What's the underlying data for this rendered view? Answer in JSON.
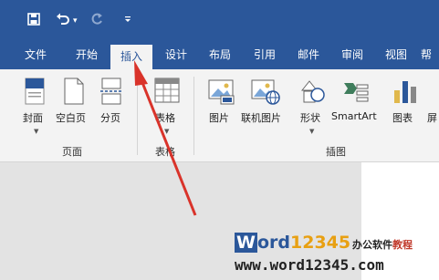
{
  "tabs": [
    "文件",
    "开始",
    "插入",
    "设计",
    "布局",
    "引用",
    "邮件",
    "审阅",
    "视图",
    "帮"
  ],
  "active_tab": "插入",
  "ribbon": {
    "pages_group": {
      "label": "页面",
      "buttons": [
        "封面",
        "空白页",
        "分页"
      ]
    },
    "tables_group": {
      "label": "表格",
      "buttons": [
        "表格"
      ]
    },
    "illustrations_group": {
      "label": "插图",
      "buttons": [
        "图片",
        "联机图片",
        "形状",
        "SmartArt",
        "图表",
        "屏"
      ]
    }
  },
  "watermark": {
    "brand_w": "W",
    "brand_ord": "ord",
    "brand_num": "12345",
    "subtitle_a": "办公软件",
    "subtitle_b": "教程",
    "url": "www.word12345.com"
  },
  "colors": {
    "accent": "#2b579a",
    "arrow": "#d9332a",
    "watermark_num": "#e8a012",
    "watermark_sub_b": "#c0392b"
  }
}
